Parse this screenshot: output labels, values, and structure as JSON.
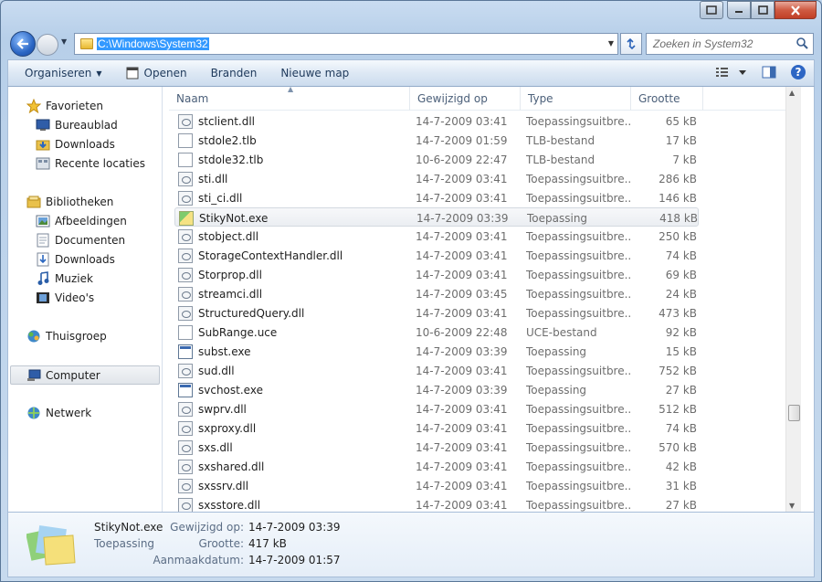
{
  "address": {
    "path": "C:\\Windows\\System32"
  },
  "search": {
    "placeholder": "Zoeken in System32"
  },
  "toolbar": {
    "organize": "Organiseren",
    "open": "Openen",
    "burn": "Branden",
    "new_folder": "Nieuwe map"
  },
  "sidebar": {
    "favorites": {
      "label": "Favorieten",
      "items": [
        "Bureaublad",
        "Downloads",
        "Recente locaties"
      ]
    },
    "libraries": {
      "label": "Bibliotheken",
      "items": [
        "Afbeeldingen",
        "Documenten",
        "Downloads",
        "Muziek",
        "Video's"
      ]
    },
    "homegroup": "Thuisgroep",
    "computer": "Computer",
    "network": "Netwerk"
  },
  "columns": {
    "name": "Naam",
    "modified": "Gewijzigd op",
    "type": "Type",
    "size": "Grootte"
  },
  "files": [
    {
      "name": "stclient.dll",
      "modified": "14-7-2009 03:41",
      "type": "Toepassingsuitbre...",
      "size": "65 kB",
      "icon": "dll"
    },
    {
      "name": "stdole2.tlb",
      "modified": "14-7-2009 01:59",
      "type": "TLB-bestand",
      "size": "17 kB",
      "icon": "doc"
    },
    {
      "name": "stdole32.tlb",
      "modified": "10-6-2009 22:47",
      "type": "TLB-bestand",
      "size": "7 kB",
      "icon": "doc"
    },
    {
      "name": "sti.dll",
      "modified": "14-7-2009 03:41",
      "type": "Toepassingsuitbre...",
      "size": "286 kB",
      "icon": "dll"
    },
    {
      "name": "sti_ci.dll",
      "modified": "14-7-2009 03:41",
      "type": "Toepassingsuitbre...",
      "size": "146 kB",
      "icon": "dll"
    },
    {
      "name": "StikyNot.exe",
      "modified": "14-7-2009 03:39",
      "type": "Toepassing",
      "size": "418 kB",
      "icon": "sticky",
      "selected": true
    },
    {
      "name": "stobject.dll",
      "modified": "14-7-2009 03:41",
      "type": "Toepassingsuitbre...",
      "size": "250 kB",
      "icon": "dll"
    },
    {
      "name": "StorageContextHandler.dll",
      "modified": "14-7-2009 03:41",
      "type": "Toepassingsuitbre...",
      "size": "74 kB",
      "icon": "dll"
    },
    {
      "name": "Storprop.dll",
      "modified": "14-7-2009 03:41",
      "type": "Toepassingsuitbre...",
      "size": "69 kB",
      "icon": "dll"
    },
    {
      "name": "streamci.dll",
      "modified": "14-7-2009 03:45",
      "type": "Toepassingsuitbre...",
      "size": "24 kB",
      "icon": "dll"
    },
    {
      "name": "StructuredQuery.dll",
      "modified": "14-7-2009 03:41",
      "type": "Toepassingsuitbre...",
      "size": "473 kB",
      "icon": "dll"
    },
    {
      "name": "SubRange.uce",
      "modified": "10-6-2009 22:48",
      "type": "UCE-bestand",
      "size": "92 kB",
      "icon": "doc"
    },
    {
      "name": "subst.exe",
      "modified": "14-7-2009 03:39",
      "type": "Toepassing",
      "size": "15 kB",
      "icon": "exe"
    },
    {
      "name": "sud.dll",
      "modified": "14-7-2009 03:41",
      "type": "Toepassingsuitbre...",
      "size": "752 kB",
      "icon": "dll"
    },
    {
      "name": "svchost.exe",
      "modified": "14-7-2009 03:39",
      "type": "Toepassing",
      "size": "27 kB",
      "icon": "exe"
    },
    {
      "name": "swprv.dll",
      "modified": "14-7-2009 03:41",
      "type": "Toepassingsuitbre...",
      "size": "512 kB",
      "icon": "dll"
    },
    {
      "name": "sxproxy.dll",
      "modified": "14-7-2009 03:41",
      "type": "Toepassingsuitbre...",
      "size": "74 kB",
      "icon": "dll"
    },
    {
      "name": "sxs.dll",
      "modified": "14-7-2009 03:41",
      "type": "Toepassingsuitbre...",
      "size": "570 kB",
      "icon": "dll"
    },
    {
      "name": "sxshared.dll",
      "modified": "14-7-2009 03:41",
      "type": "Toepassingsuitbre...",
      "size": "42 kB",
      "icon": "dll"
    },
    {
      "name": "sxssrv.dll",
      "modified": "14-7-2009 03:41",
      "type": "Toepassingsuitbre...",
      "size": "31 kB",
      "icon": "dll"
    },
    {
      "name": "sxsstore.dll",
      "modified": "14-7-2009 03:41",
      "type": "Toepassingsuitbre...",
      "size": "27 kB",
      "icon": "dll"
    }
  ],
  "details": {
    "name": "StikyNot.exe",
    "type": "Toepassing",
    "modified_label": "Gewijzigd op:",
    "modified_value": "14-7-2009 03:39",
    "size_label": "Grootte:",
    "size_value": "417 kB",
    "created_label": "Aanmaakdatum:",
    "created_value": "14-7-2009 01:57"
  },
  "colors": {
    "accent": "#3399ff",
    "frame": "#c7daee",
    "link": "#1e395b"
  }
}
